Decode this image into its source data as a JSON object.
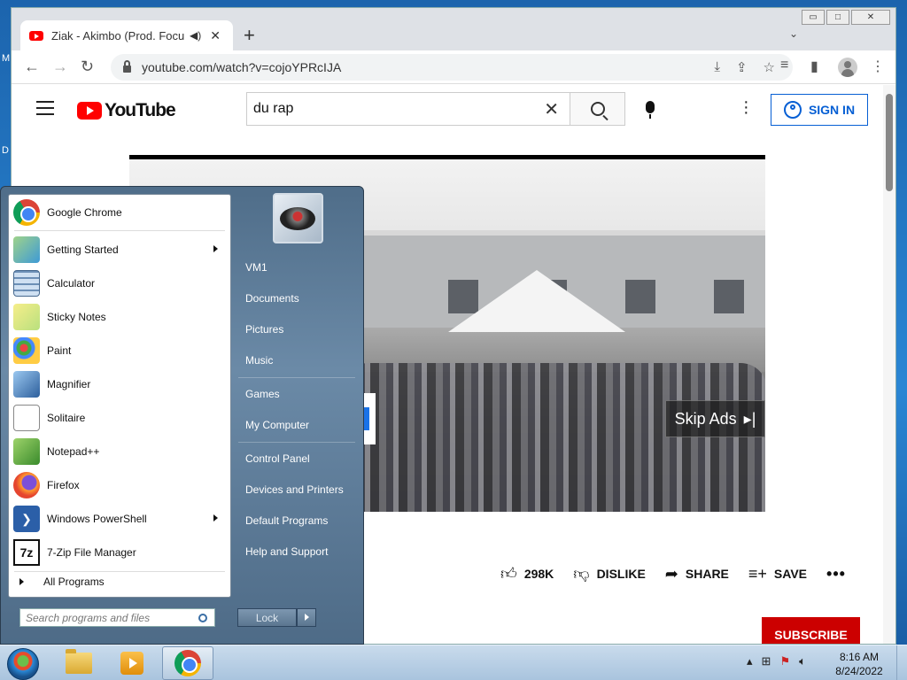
{
  "desktop": {
    "icon_letters": [
      "M",
      "D"
    ]
  },
  "browser": {
    "tab_title": "Ziak - Akimbo (Prod. Focus B",
    "url": "youtube.com/watch?v=cojoYPRcIJA",
    "window_controls": [
      "minimize",
      "maximize",
      "close"
    ]
  },
  "youtube": {
    "logo_text": "YouTube",
    "search_value": "du rap",
    "sign_in_label": "SIGN IN",
    "skip_ads_label": "Skip Ads",
    "actions": {
      "likes": "298K",
      "dislike": "DISLIKE",
      "share": "SHARE",
      "save": "SAVE"
    },
    "subscribe_label": "SUBSCRIBE"
  },
  "start_menu": {
    "programs": [
      {
        "label": "Google Chrome",
        "icon": "chrome-icon",
        "submenu": false
      },
      {
        "label": "Getting Started",
        "icon": "getting-started-icon",
        "submenu": true
      },
      {
        "label": "Calculator",
        "icon": "calculator-icon",
        "submenu": false
      },
      {
        "label": "Sticky Notes",
        "icon": "sticky-notes-icon",
        "submenu": false
      },
      {
        "label": "Paint",
        "icon": "paint-icon",
        "submenu": false
      },
      {
        "label": "Magnifier",
        "icon": "magnifier-icon",
        "submenu": false
      },
      {
        "label": "Solitaire",
        "icon": "solitaire-icon",
        "submenu": false
      },
      {
        "label": "Notepad++",
        "icon": "notepad-plus-icon",
        "submenu": false
      },
      {
        "label": "Firefox",
        "icon": "firefox-icon",
        "submenu": false
      },
      {
        "label": "Windows PowerShell",
        "icon": "powershell-icon",
        "submenu": true
      },
      {
        "label": "7-Zip File Manager",
        "icon": "seven-zip-icon",
        "submenu": false
      }
    ],
    "all_programs": "All Programs",
    "search_placeholder": "Search programs and files",
    "right_items": [
      "VM1",
      "Documents",
      "Pictures",
      "Music",
      "Games",
      "My Computer",
      "Control Panel",
      "Devices and Printers",
      "Default Programs",
      "Help and Support"
    ],
    "lock_label": "Lock"
  },
  "taskbar": {
    "time": "8:16 AM",
    "date": "8/24/2022"
  }
}
